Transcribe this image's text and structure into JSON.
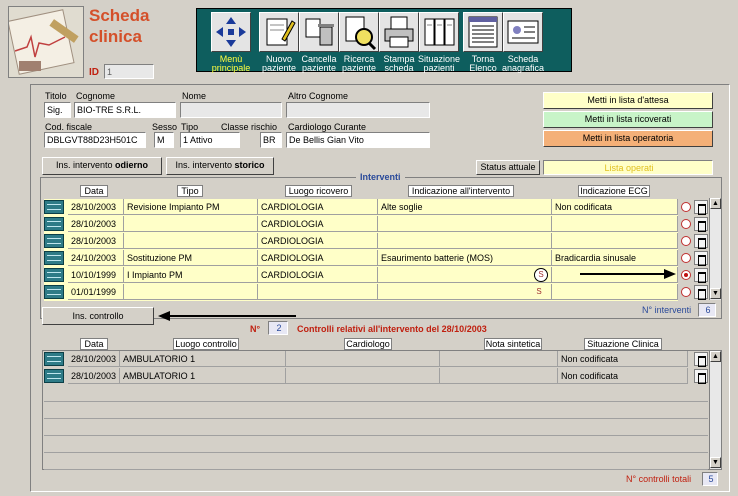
{
  "header": {
    "title_line1": "Scheda",
    "title_line2": "clinica",
    "id_label": "ID",
    "id_value": "1"
  },
  "toolbar": {
    "buttons": [
      {
        "line1": "Menù",
        "line2": "principale",
        "icon": "arrows-icon"
      },
      {
        "line1": "Nuovo",
        "line2": "paziente",
        "icon": "new-document-icon"
      },
      {
        "line1": "Cancella",
        "line2": "paziente",
        "icon": "delete-trash-icon"
      },
      {
        "line1": "Ricerca",
        "line2": "paziente",
        "icon": "search-icon"
      },
      {
        "line1": "Stampa",
        "line2": "scheda",
        "icon": "printer-icon"
      },
      {
        "line1": "Situazione",
        "line2": "pazienti",
        "icon": "folders-icon"
      },
      {
        "line1": "Torna",
        "line2": "Elenco",
        "icon": "list-icon"
      },
      {
        "line1": "Scheda",
        "line2": "anagrafica",
        "icon": "id-card-icon"
      }
    ]
  },
  "patient": {
    "titolo_label": "Titolo",
    "titolo": "Sig.",
    "cognome_label": "Cognome",
    "cognome": "BIO-TRE S.R.L.",
    "nome_label": "Nome",
    "nome": "",
    "altro_cognome_label": "Altro Cognome",
    "altro_cognome": "",
    "cod_fiscale_label": "Cod. fiscale",
    "cod_fiscale": "DBLGVT88D23H501C",
    "sesso_label": "Sesso",
    "sesso": "M",
    "tipo_label": "Tipo",
    "tipo": "1 Attivo",
    "classe_rischio_label": "Classe rischio",
    "classe_rischio": "BR",
    "cardiologo_label": "Cardiologo Curante",
    "cardiologo": "De Bellis  Gian Vito"
  },
  "list_buttons": {
    "attesa": "Metti in lista d'attesa",
    "ricoverati": "Metti in lista ricoverati",
    "operatoria": "Metti in lista operatoria"
  },
  "actions": {
    "ins_odierno_prefix": "Ins. intervento ",
    "ins_odierno_bold": "odierno",
    "ins_storico_prefix": "Ins. intervento ",
    "ins_storico_bold": "storico",
    "status_label": "Status attuale",
    "status_value": "Lista operati"
  },
  "interventi": {
    "title": "Interventi",
    "columns": [
      "Data",
      "Tipo",
      "Luogo ricovero",
      "Indicazione all'intervento",
      "Indicazione ECG"
    ],
    "rows": [
      {
        "data": "28/10/2003",
        "tipo": "Revisione Impianto  PM",
        "luogo": "CARDIOLOGIA",
        "indicazione": "Alte soglie",
        "ecg": "Non codificata",
        "s": "",
        "selected": false
      },
      {
        "data": "28/10/2003",
        "tipo": "",
        "luogo": "CARDIOLOGIA",
        "indicazione": "",
        "ecg": "",
        "s": "",
        "selected": false
      },
      {
        "data": "28/10/2003",
        "tipo": "",
        "luogo": "CARDIOLOGIA",
        "indicazione": "",
        "ecg": "",
        "s": "",
        "selected": false
      },
      {
        "data": "24/10/2003",
        "tipo": "Sostituzione  PM",
        "luogo": "CARDIOLOGIA",
        "indicazione": "Esaurimento batterie (MOS)",
        "ecg": "Bradicardia sinusale",
        "s": "",
        "selected": false
      },
      {
        "data": "10/10/1999",
        "tipo": "I Impianto  PM",
        "luogo": "CARDIOLOGIA",
        "indicazione": "",
        "ecg": "",
        "s": "S",
        "selected": true
      },
      {
        "data": "01/01/1999",
        "tipo": "",
        "luogo": "",
        "indicazione": "",
        "ecg": "",
        "s": "S",
        "selected": false
      }
    ],
    "count_label": "N° interventi",
    "count": "6"
  },
  "controlli": {
    "ins_button": "Ins. controllo",
    "n_label": "N°",
    "n_value": "2",
    "title": "Controlli relativi all'intervento del  28/10/2003",
    "columns": [
      "Data",
      "Luogo controllo",
      "Cardiologo",
      "Nota sintetica",
      "Situazione Clinica"
    ],
    "rows": [
      {
        "data": "28/10/2003",
        "luogo": "AMBULATORIO 1",
        "cardiologo": "",
        "nota": "",
        "situazione": "Non codificata"
      },
      {
        "data": "28/10/2003",
        "luogo": "AMBULATORIO 1",
        "cardiologo": "",
        "nota": "",
        "situazione": "Non codificata"
      }
    ],
    "total_label": "N° controlli totali",
    "total": "5"
  },
  "colors": {
    "toolbar_bg": "#0e5e5e",
    "title_orange": "#d4502a",
    "row_yellow": "#ffffc8",
    "btn_attesa": "#ffffc8",
    "btn_ricoverati": "#c8f4c8",
    "btn_operatoria": "#f4b078"
  }
}
